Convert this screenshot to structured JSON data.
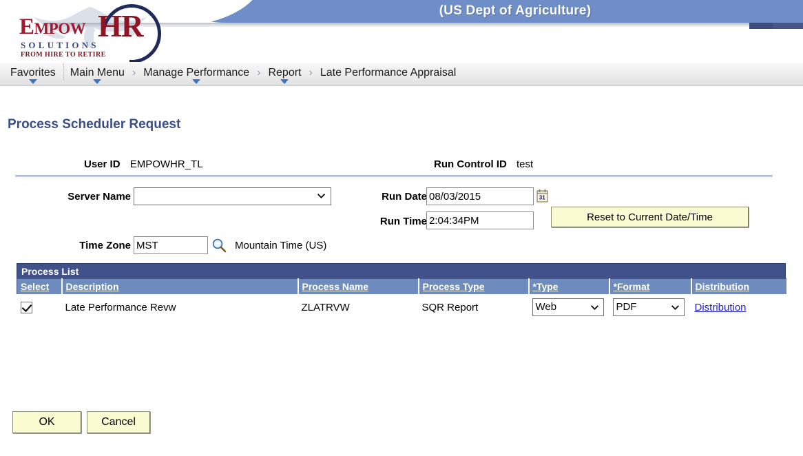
{
  "header": {
    "agency_title": "(US Dept of Agriculture)",
    "logo": {
      "word_empow": "Empow",
      "word_hr": "HR",
      "solutions": "SOLUTIONS",
      "tagline": "FROM HIRE TO RETIRE"
    },
    "colors": {
      "banner_blue": "#6f8ec7",
      "banner_dark": "#3c4a7e",
      "logo_red": "#9e1b32",
      "logo_navy": "#1f2a5a"
    }
  },
  "breadcrumb": {
    "items": [
      {
        "label": "Favorites",
        "has_caret": true
      },
      {
        "label": "Main Menu",
        "has_caret": true
      },
      {
        "label": "Manage Performance",
        "has_caret": true
      },
      {
        "label": "Report",
        "has_caret": true
      },
      {
        "label": "Late Performance Appraisal",
        "has_caret": false
      }
    ],
    "separator": "›"
  },
  "page": {
    "title": "Process Scheduler Request"
  },
  "form": {
    "user_id_label": "User ID",
    "user_id_value": "EMPOWHR_TL",
    "run_control_label": "Run Control ID",
    "run_control_value": "test",
    "server_name_label": "Server Name",
    "server_name_value": "",
    "server_name_options": [
      ""
    ],
    "run_date_label": "Run Date",
    "run_date_value": "08/03/2015",
    "calendar_icon_day": "31",
    "run_time_label": "Run Time",
    "run_time_value": "2:04:34PM",
    "reset_button_label": "Reset to Current Date/Time",
    "time_zone_label": "Time Zone",
    "time_zone_value": "MST",
    "time_zone_description": "Mountain Time (US)"
  },
  "process_list": {
    "title": "Process List",
    "columns": [
      "Select",
      "Description",
      "Process Name",
      "Process Type",
      "*Type",
      "*Format",
      "Distribution"
    ],
    "rows": [
      {
        "selected": true,
        "description": "Late Performance Revw",
        "process_name": "ZLATRVW",
        "process_type": "SQR Report",
        "type": "Web",
        "type_options": [
          "Web"
        ],
        "format": "PDF",
        "format_options": [
          "PDF"
        ],
        "distribution_link": "Distribution"
      }
    ]
  },
  "footer": {
    "ok_label": "OK",
    "cancel_label": "Cancel"
  }
}
